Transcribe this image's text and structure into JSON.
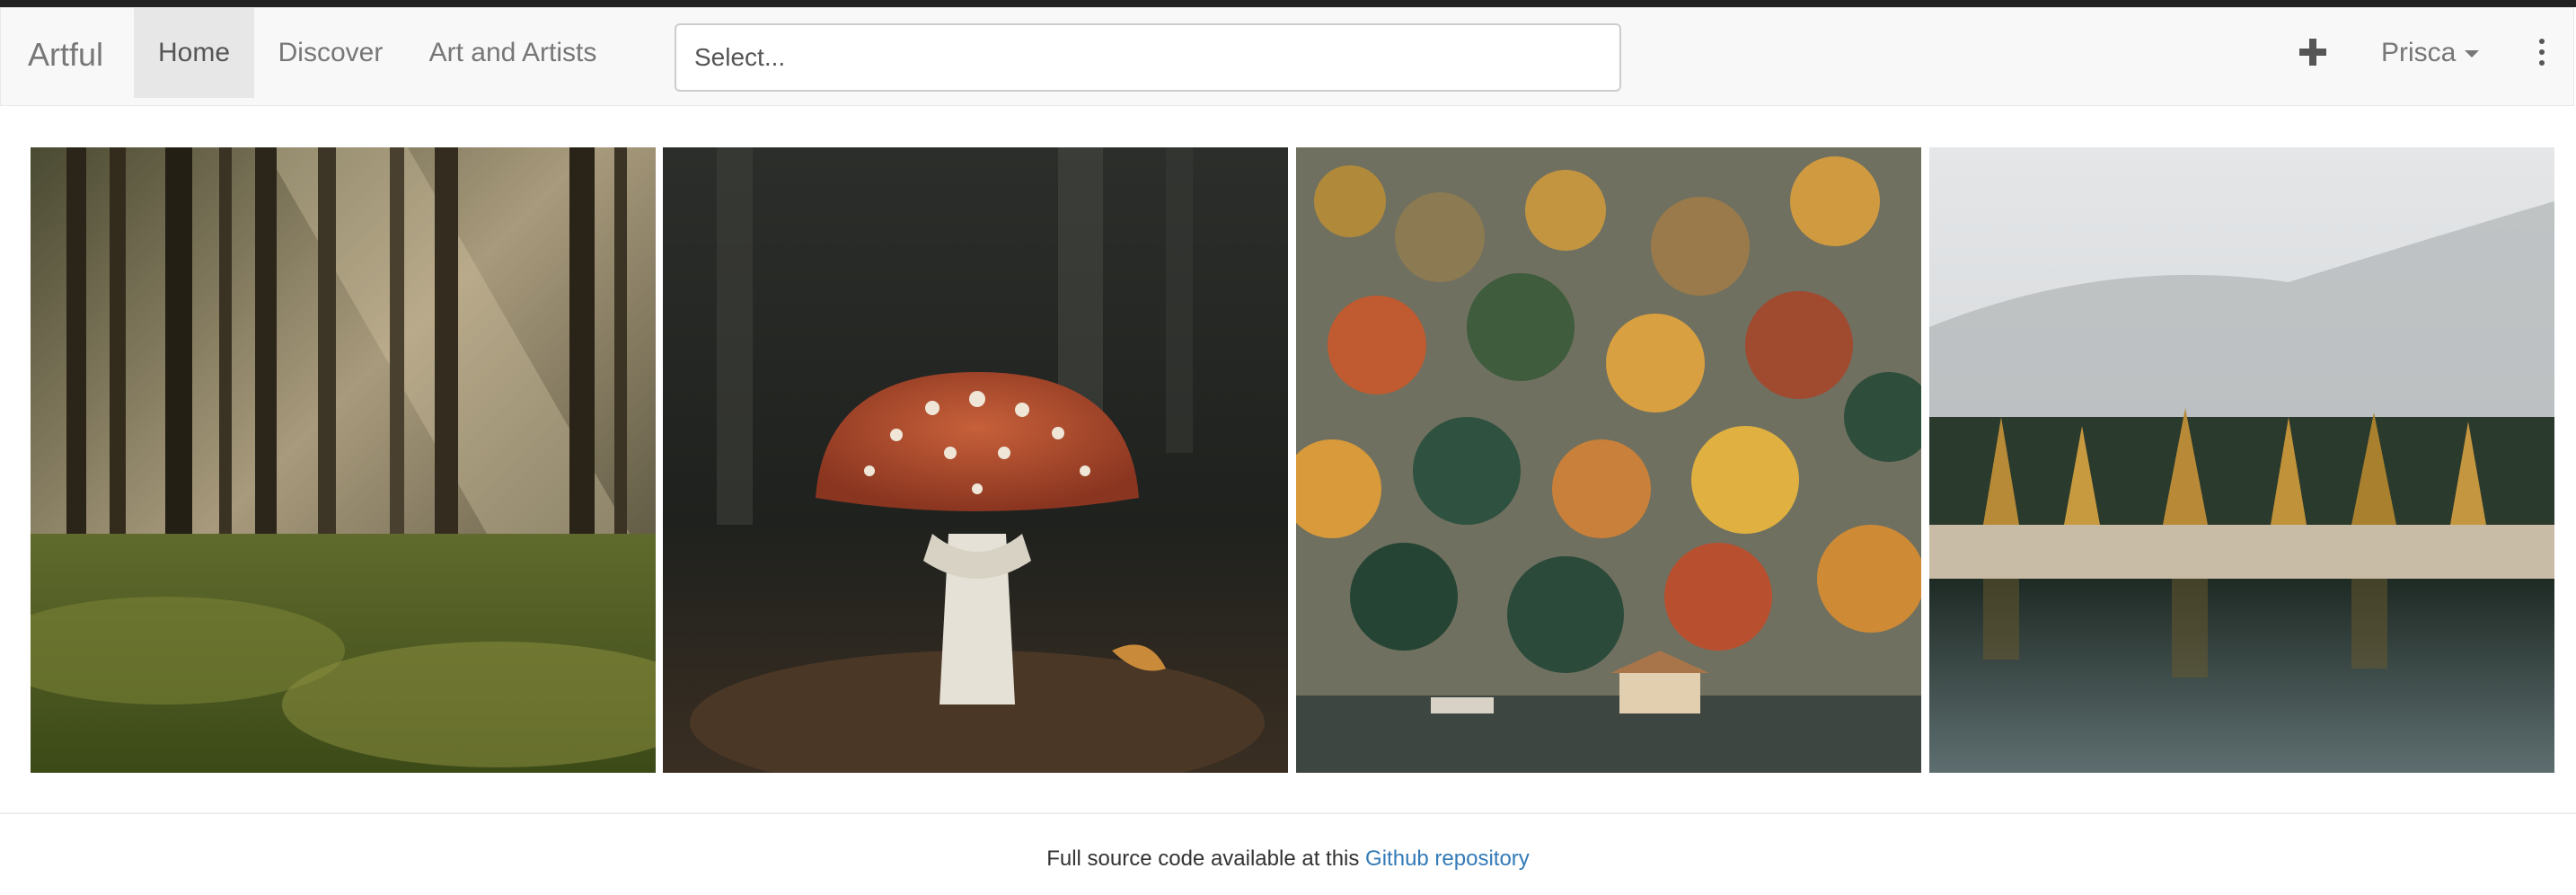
{
  "navbar": {
    "brand": "Artful",
    "items": [
      {
        "label": "Home",
        "active": true
      },
      {
        "label": "Discover",
        "active": false
      },
      {
        "label": "Art and Artists",
        "active": false
      }
    ],
    "search": {
      "placeholder": "Select...",
      "value": ""
    },
    "add_icon": "plus-icon",
    "user": {
      "name": "Prisca",
      "icon": "caret-down-icon"
    },
    "more_icon": "kebab-menu-icon"
  },
  "gallery": {
    "images": [
      {
        "alt": "forest-sunrays-photo"
      },
      {
        "alt": "red-mushroom-photo"
      },
      {
        "alt": "autumn-hillside-lake-photo"
      },
      {
        "alt": "misty-forest-lake-reflection-photo"
      }
    ]
  },
  "footer": {
    "text": "Full source code available at this",
    "link_label": "Github repository",
    "link_color": "#337ab7"
  },
  "colors": {
    "navbar_bg": "#f8f8f8",
    "active_bg": "#e7e7e7",
    "text_muted": "#777777"
  }
}
